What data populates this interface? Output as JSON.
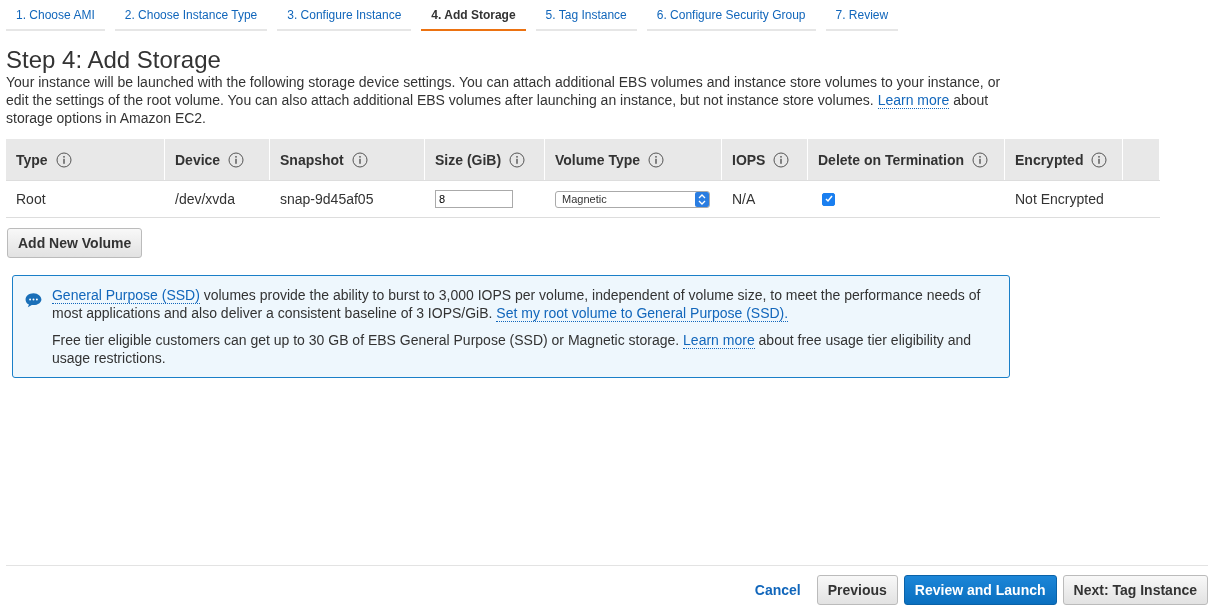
{
  "tabs": [
    {
      "label": "1. Choose AMI",
      "selected": false
    },
    {
      "label": "2. Choose Instance Type",
      "selected": false
    },
    {
      "label": "3. Configure Instance",
      "selected": false
    },
    {
      "label": "4. Add Storage",
      "selected": true
    },
    {
      "label": "5. Tag Instance",
      "selected": false
    },
    {
      "label": "6. Configure Security Group",
      "selected": false
    },
    {
      "label": "7. Review",
      "selected": false
    }
  ],
  "title": "Step 4: Add Storage",
  "intro": [
    {
      "kind": "text",
      "text": "Your instance will be launched with the following storage device settings. You can attach additional EBS volumes and instance store volumes to your instance, or edit the settings of the root volume. You can also attach additional EBS volumes after launching an instance, but not instance store volumes. "
    },
    {
      "kind": "link",
      "text": "Learn more"
    },
    {
      "kind": "text",
      "text": " about storage options in Amazon EC2."
    }
  ],
  "table": {
    "columns": [
      "Type",
      "Device",
      "Snapshot",
      "Size (GiB)",
      "Volume Type",
      "IOPS",
      "Delete on Termination",
      "Encrypted"
    ],
    "rows": [
      {
        "type": "Root",
        "device": "/dev/xvda",
        "snapshot": "snap-9d45af05",
        "size": "8",
        "volume_type": "Magnetic",
        "iops": "N/A",
        "delete_on_termination": true,
        "encrypted": "Not Encrypted"
      }
    ]
  },
  "add_button": "Add New Volume",
  "info": [
    [
      {
        "kind": "link",
        "text": "General Purpose (SSD)"
      },
      {
        "kind": "text",
        "text": " volumes provide the ability to burst to 3,000 IOPS per volume, independent of volume size, to meet the performance needs of most applications and also deliver a consistent baseline of 3 IOPS/GiB. "
      },
      {
        "kind": "link",
        "text": "Set my root volume to General Purpose (SSD)."
      }
    ],
    [
      {
        "kind": "text",
        "text": "Free tier eligible customers can get up to 30 GB of EBS General Purpose (SSD) or Magnetic storage. "
      },
      {
        "kind": "link",
        "text": "Learn more"
      },
      {
        "kind": "text",
        "text": " about free usage tier eligibility and usage restrictions."
      }
    ]
  ],
  "footer": {
    "cancel": "Cancel",
    "previous": "Previous",
    "primary": "Review and Launch",
    "next": "Next: Tag Instance"
  }
}
